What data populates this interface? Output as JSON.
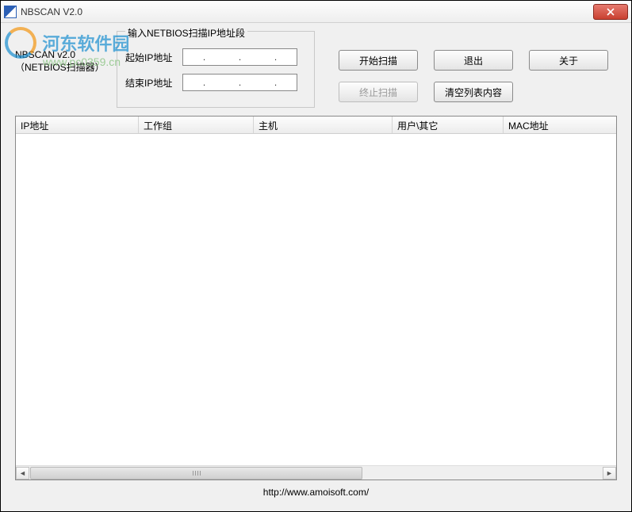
{
  "window": {
    "title": "NBSCAN V2.0"
  },
  "watermark": {
    "text1": "河东软件园",
    "text2": "www.pc0359.cn"
  },
  "header": {
    "app_name_line1": "NBSCAN v2.0",
    "app_name_line2": "（NETBIOS扫描器）",
    "group_title": "输入NETBIOS扫描IP地址段",
    "start_ip_label": "起始IP地址",
    "end_ip_label": "结束IP地址"
  },
  "buttons": {
    "start": "开始扫描",
    "exit": "退出",
    "about": "关于",
    "stop": "终止扫描",
    "clear": "清空列表内容"
  },
  "table": {
    "columns": [
      "IP地址",
      "工作组",
      "主机",
      "用户\\其它",
      "MAC地址"
    ],
    "rows": []
  },
  "footer": {
    "url": "http://www.amoisoft.com/"
  }
}
